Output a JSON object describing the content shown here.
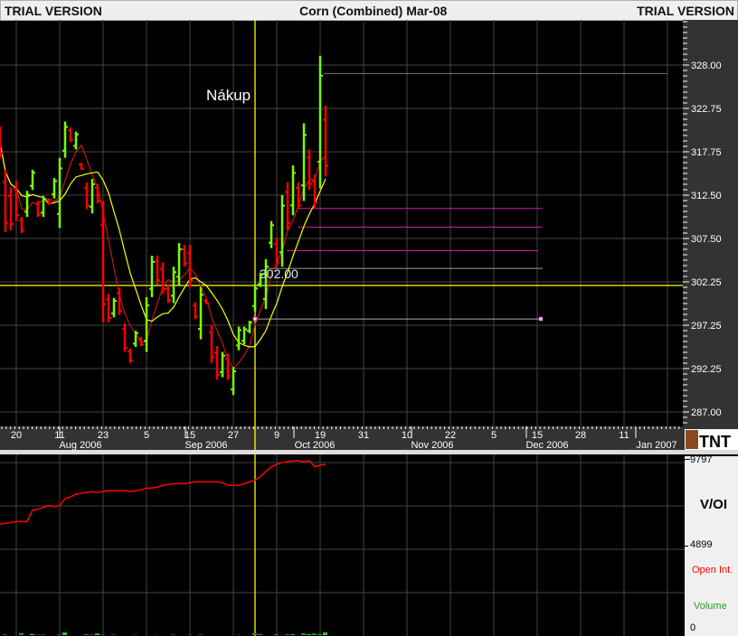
{
  "header": {
    "left": "TRIAL VERSION",
    "title": "Corn (Combined) Mar-08",
    "right": "TRIAL VERSION"
  },
  "annotations": {
    "buy_label": "Nákup",
    "price_label": "302.00",
    "logo_text": "TNT"
  },
  "colors": {
    "up": "#7cfc00",
    "down": "#ff0000",
    "ma_short": "#c01818",
    "ma_long": "#ffff00",
    "open_interest": "#ff0000",
    "volume": "#2ecc2e",
    "levels": "#d020a0"
  },
  "price_axis": {
    "labels": [
      "328.00",
      "322.75",
      "317.75",
      "312.50",
      "307.50",
      "302.25",
      "297.25",
      "292.25",
      "287.00"
    ]
  },
  "date_axis": {
    "days": [
      "20",
      "11",
      "23",
      "5",
      "15",
      "27",
      "9",
      "19",
      "31",
      "10",
      "22",
      "5",
      "15",
      "28",
      "11"
    ],
    "months": [
      "Aug 2006",
      "Sep 2006",
      "Oct 2006",
      "Nov 2006",
      "Dec 2006",
      "Jan 2007"
    ]
  },
  "lower_panel": {
    "title": "V/OI",
    "max_label": "9797",
    "mid_label": "4899",
    "min_label": "0",
    "legend_oi": "Open Int.",
    "legend_volume": "Volume"
  },
  "chart_data": {
    "type": "ohlc",
    "title": "Corn (Combined) Mar-08",
    "ylim": [
      286,
      331
    ],
    "bars": [
      [
        320.7,
        317.0,
        "d"
      ],
      [
        315.6,
        308.2,
        "d"
      ],
      [
        313.5,
        308.4,
        "d"
      ],
      [
        314.3,
        309.5,
        "d"
      ],
      [
        310.0,
        308.1,
        "d"
      ],
      [
        313.1,
        310.0,
        "u"
      ],
      [
        315.6,
        313.2,
        "u"
      ],
      [
        311.9,
        310.0,
        "d"
      ],
      [
        312.5,
        310.0,
        "u"
      ],
      [
        312.2,
        311.5,
        "d"
      ],
      [
        314.6,
        312.2,
        "u"
      ],
      [
        317.0,
        308.7,
        "u"
      ],
      [
        321.3,
        317.0,
        "u"
      ],
      [
        320.6,
        318.9,
        "d"
      ],
      [
        320.1,
        318.0,
        "u"
      ],
      [
        316.4,
        315.6,
        "d"
      ],
      [
        314.1,
        310.9,
        "d"
      ],
      [
        314.5,
        310.4,
        "u"
      ],
      [
        313.9,
        311.6,
        "d"
      ],
      [
        311.9,
        297.5,
        "d"
      ],
      [
        300.9,
        297.5,
        "d"
      ],
      [
        300.4,
        298.1,
        "u"
      ],
      [
        301.6,
        298.4,
        "d"
      ],
      [
        297.4,
        294.0,
        "d"
      ],
      [
        294.4,
        292.7,
        "d"
      ],
      [
        296.5,
        294.6,
        "u"
      ],
      [
        295.8,
        294.7,
        "d"
      ],
      [
        300.5,
        294.0,
        "u"
      ],
      [
        305.4,
        300.5,
        "u"
      ],
      [
        305.4,
        302.0,
        "d"
      ],
      [
        304.6,
        300.9,
        "d"
      ],
      [
        301.9,
        299.8,
        "d"
      ],
      [
        304.1,
        299.8,
        "u"
      ],
      [
        306.9,
        301.9,
        "u"
      ],
      [
        306.7,
        304.1,
        "d"
      ],
      [
        306.7,
        301.7,
        "d"
      ],
      [
        299.9,
        297.9,
        "d"
      ],
      [
        301.7,
        295.5,
        "u"
      ],
      [
        300.2,
        299.7,
        "d"
      ],
      [
        297.2,
        292.7,
        "d"
      ],
      [
        294.7,
        290.7,
        "d"
      ],
      [
        294.0,
        291.0,
        "u"
      ],
      [
        293.8,
        290.7,
        "d"
      ],
      [
        292.2,
        288.9,
        "u"
      ],
      [
        297.0,
        294.2,
        "u"
      ],
      [
        297.0,
        294.9,
        "u"
      ],
      [
        297.7,
        296.2,
        "u"
      ],
      [
        302.0,
        298.8,
        "u"
      ],
      [
        303.4,
        301.7,
        "u"
      ],
      [
        305.0,
        299.1,
        "u"
      ],
      [
        309.5,
        306.3,
        "u"
      ],
      [
        307.5,
        304.1,
        "d"
      ],
      [
        312.6,
        304.1,
        "u"
      ],
      [
        314.1,
        308.4,
        "d"
      ],
      [
        316.1,
        310.2,
        "u"
      ],
      [
        314.1,
        310.9,
        "d"
      ],
      [
        321.1,
        311.9,
        "u"
      ],
      [
        318.0,
        313.2,
        "d"
      ],
      [
        315.0,
        311.1,
        "d"
      ],
      [
        329.1,
        313.4,
        "u"
      ],
      [
        323.2,
        314.8,
        "d"
      ]
    ],
    "ma_periods": [
      4,
      9
    ],
    "reference_price": 302.0,
    "level_lines": [
      327.0,
      311.0,
      308.8,
      306.0,
      303.9,
      297.9
    ],
    "volume": [
      0,
      40,
      0,
      0,
      120,
      0,
      60,
      20,
      30,
      0,
      0,
      30,
      150,
      0,
      0,
      0,
      50,
      30,
      90,
      20,
      0,
      20,
      0,
      0,
      0,
      20,
      0,
      0,
      0,
      10,
      0,
      0,
      30,
      0,
      0,
      20,
      0,
      30,
      0,
      0,
      0,
      0,
      0,
      0,
      20,
      0,
      0,
      120,
      40,
      0,
      0,
      30,
      10,
      50,
      40,
      0,
      110,
      50,
      100,
      70,
      150
    ],
    "open_interest": [
      6300,
      6350,
      6400,
      6450,
      6450,
      6450,
      7100,
      7150,
      7250,
      7350,
      7300,
      7350,
      7750,
      7850,
      8000,
      8050,
      8100,
      8150,
      8100,
      8150,
      8200,
      8200,
      8200,
      8200,
      8150,
      8200,
      8250,
      8350,
      8350,
      8400,
      8500,
      8550,
      8600,
      8600,
      8600,
      8650,
      8700,
      8700,
      8700,
      8700,
      8700,
      8650,
      8500,
      8500,
      8500,
      8600,
      8700,
      8800,
      9000,
      9300,
      9550,
      9700,
      9800,
      9850,
      9900,
      9900,
      9850,
      9900,
      9550,
      9650,
      9700
    ]
  }
}
